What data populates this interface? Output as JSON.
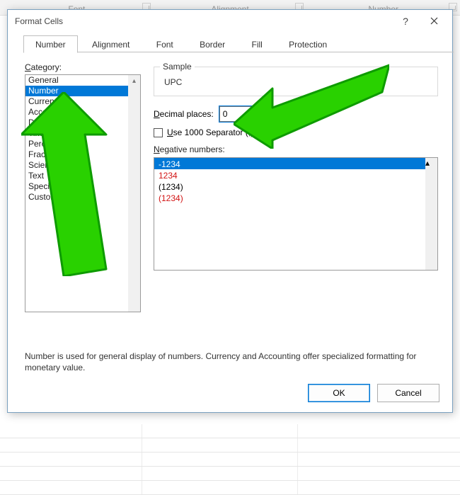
{
  "ribbon": {
    "font": "Font",
    "alignment": "Alignment",
    "number": "Number"
  },
  "dialog": {
    "title": "Format Cells",
    "tabs": [
      "Number",
      "Alignment",
      "Font",
      "Border",
      "Fill",
      "Protection"
    ],
    "activeTab": 0,
    "categoryLabel": "Category:",
    "categories": [
      "General",
      "Number",
      "Currency",
      "Accounting",
      "Date",
      "Time",
      "Percentage",
      "Fraction",
      "Scientific",
      "Text",
      "Special",
      "Custom"
    ],
    "categorySelectedIndex": 1,
    "sampleLabel": "Sample",
    "sampleValue": "UPC",
    "decimalLabel_pre": "D",
    "decimalLabel_post": "ecimal places:",
    "decimalValue": "0",
    "useSepLabel_pre": "U",
    "useSepLabel_post": "se 1000 Separator (,)",
    "negLabel_pre": "N",
    "negLabel_post": "egative numbers:",
    "negOptions": [
      {
        "text": "-1234",
        "red": false,
        "selected": true
      },
      {
        "text": "1234",
        "red": true,
        "selected": false
      },
      {
        "text": "(1234)",
        "red": false,
        "selected": false
      },
      {
        "text": "(1234)",
        "red": true,
        "selected": false
      }
    ],
    "description": "Number is used for general display of numbers.  Currency and Accounting offer specialized formatting for monetary value.",
    "ok": "OK",
    "cancel": "Cancel"
  },
  "arrows": {
    "color": "#29d100",
    "stroke": "#0e9b00"
  }
}
